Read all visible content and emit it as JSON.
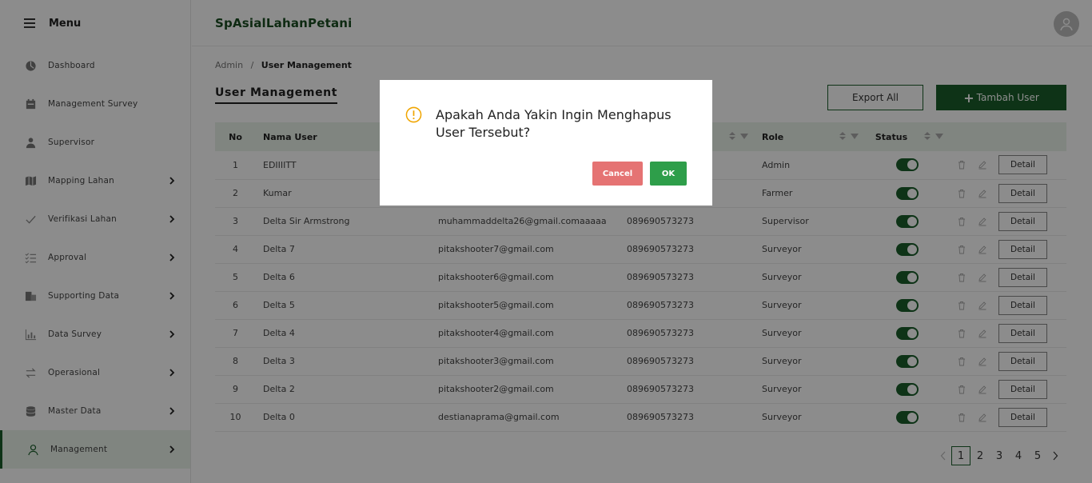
{
  "sidebar": {
    "title": "Menu",
    "items": [
      {
        "label": "Dashboard",
        "icon": "dashboard-icon",
        "has_children": false
      },
      {
        "label": "Management Survey",
        "icon": "calendar-icon",
        "has_children": false
      },
      {
        "label": "Supervisor",
        "icon": "user-tie-icon",
        "has_children": false
      },
      {
        "label": "Mapping Lahan",
        "icon": "map-icon",
        "has_children": true
      },
      {
        "label": "Verifikasi Lahan",
        "icon": "check-icon",
        "has_children": true
      },
      {
        "label": "Approval",
        "icon": "list-check-icon",
        "has_children": true
      },
      {
        "label": "Supporting Data",
        "icon": "files-icon",
        "has_children": true
      },
      {
        "label": "Data Survey",
        "icon": "bar-chart-icon",
        "has_children": true
      },
      {
        "label": "Operasional",
        "icon": "swap-icon",
        "has_children": true
      },
      {
        "label": "Master Data",
        "icon": "database-icon",
        "has_children": true
      },
      {
        "label": "Management",
        "icon": "user-icon",
        "has_children": true,
        "active": true
      }
    ]
  },
  "header": {
    "brand": "SpAsialLahanPetani"
  },
  "breadcrumb": {
    "root": "Admin",
    "sep": "/",
    "current": "User Management"
  },
  "page": {
    "title": "User Management"
  },
  "actions": {
    "export": "Export All",
    "add": "Tambah User"
  },
  "table": {
    "headers": {
      "no": "No",
      "name": "Nama User",
      "role": "Role",
      "status": "Status"
    },
    "detail_label": "Detail",
    "rows": [
      {
        "no": "1",
        "name": "EDIIIITT",
        "email": "",
        "phone": "",
        "role": "Admin",
        "active": true
      },
      {
        "no": "2",
        "name": "Kumar",
        "email": "",
        "phone": "",
        "role": "Farmer",
        "active": true
      },
      {
        "no": "3",
        "name": "Delta Sir Armstrong",
        "email": "muhammaddelta26@gmail.comaaaaa",
        "phone": "089690573273",
        "role": "Supervisor",
        "active": true
      },
      {
        "no": "4",
        "name": "Delta 7",
        "email": "pitakshooter7@gmail.com",
        "phone": "089690573273",
        "role": "Surveyor",
        "active": true
      },
      {
        "no": "5",
        "name": "Delta 6",
        "email": "pitakshooter6@gmail.com",
        "phone": "089690573273",
        "role": "Surveyor",
        "active": true
      },
      {
        "no": "6",
        "name": "Delta 5",
        "email": "pitakshooter5@gmail.com",
        "phone": "089690573273",
        "role": "Surveyor",
        "active": true
      },
      {
        "no": "7",
        "name": "Delta 4",
        "email": "pitakshooter4@gmail.com",
        "phone": "089690573273",
        "role": "Surveyor",
        "active": true
      },
      {
        "no": "8",
        "name": "Delta 3",
        "email": "pitakshooter3@gmail.com",
        "phone": "089690573273",
        "role": "Surveyor",
        "active": true
      },
      {
        "no": "9",
        "name": "Delta 2",
        "email": "pitakshooter2@gmail.com",
        "phone": "089690573273",
        "role": "Surveyor",
        "active": true
      },
      {
        "no": "10",
        "name": "Delta 0",
        "email": "destianaprama@gmail.com",
        "phone": "089690573273",
        "role": "Surveyor",
        "active": true
      }
    ]
  },
  "pagination": {
    "pages": [
      "1",
      "2",
      "3",
      "4",
      "5"
    ],
    "current": "1"
  },
  "modal": {
    "message": "Apakah Anda Yakin Ingin Menghapus User Tersebut?",
    "cancel": "Cancel",
    "ok": "OK"
  },
  "colors": {
    "primary": "#1b5e2b",
    "cancel": "#e57373",
    "ok": "#2e9e4a",
    "warning": "#f0a500"
  }
}
